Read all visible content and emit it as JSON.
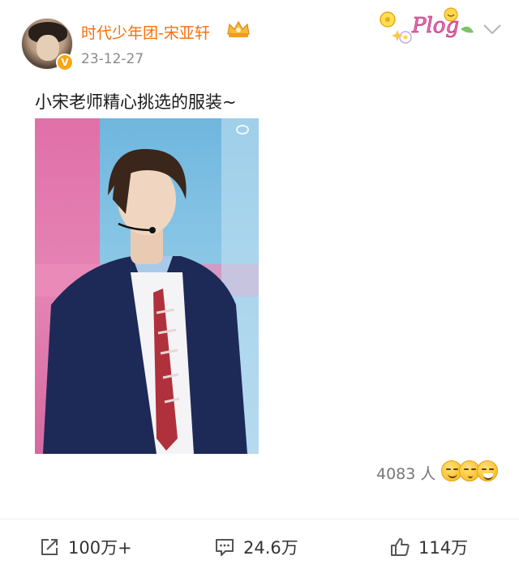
{
  "post": {
    "username": "时代少年团-宋亚轩",
    "date": "23-12-27",
    "text": "小宋老师精心挑选的服装~",
    "sticker_text": "Plog",
    "viewers": "4083 人"
  },
  "actions": {
    "share_count": "100万+",
    "comment_count": "24.6万",
    "like_count": "114万"
  },
  "icons": {
    "verified": "verified-badge-icon",
    "crown": "crown-icon",
    "more": "chevron-down-icon",
    "share": "share-icon",
    "comment": "comment-icon",
    "like": "thumbs-up-icon"
  },
  "colors": {
    "username": "#f86f0a",
    "verified": "#f7a614",
    "meta": "#8a8a8a"
  }
}
